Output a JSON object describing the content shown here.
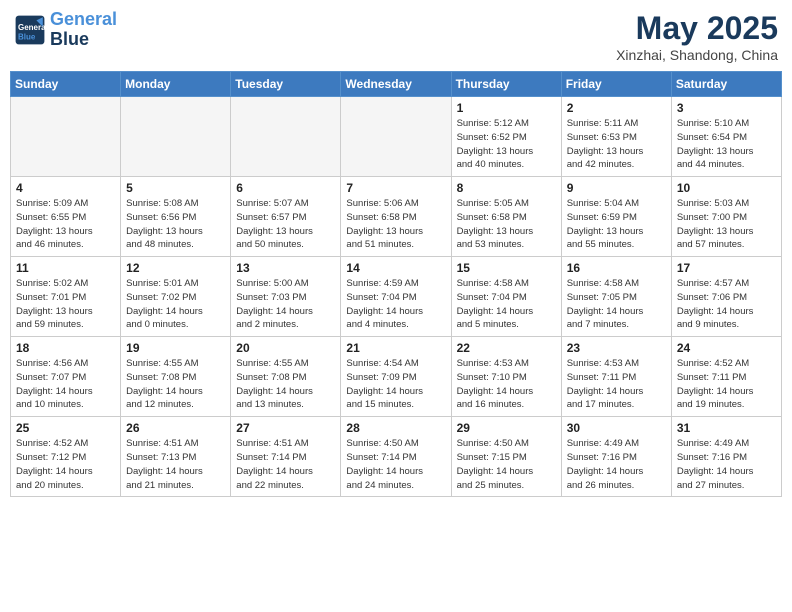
{
  "header": {
    "logo_line1": "General",
    "logo_line2": "Blue",
    "month": "May 2025",
    "location": "Xinzhai, Shandong, China"
  },
  "days_of_week": [
    "Sunday",
    "Monday",
    "Tuesday",
    "Wednesday",
    "Thursday",
    "Friday",
    "Saturday"
  ],
  "weeks": [
    [
      {
        "day": "",
        "info": ""
      },
      {
        "day": "",
        "info": ""
      },
      {
        "day": "",
        "info": ""
      },
      {
        "day": "",
        "info": ""
      },
      {
        "day": "1",
        "info": "Sunrise: 5:12 AM\nSunset: 6:52 PM\nDaylight: 13 hours\nand 40 minutes."
      },
      {
        "day": "2",
        "info": "Sunrise: 5:11 AM\nSunset: 6:53 PM\nDaylight: 13 hours\nand 42 minutes."
      },
      {
        "day": "3",
        "info": "Sunrise: 5:10 AM\nSunset: 6:54 PM\nDaylight: 13 hours\nand 44 minutes."
      }
    ],
    [
      {
        "day": "4",
        "info": "Sunrise: 5:09 AM\nSunset: 6:55 PM\nDaylight: 13 hours\nand 46 minutes."
      },
      {
        "day": "5",
        "info": "Sunrise: 5:08 AM\nSunset: 6:56 PM\nDaylight: 13 hours\nand 48 minutes."
      },
      {
        "day": "6",
        "info": "Sunrise: 5:07 AM\nSunset: 6:57 PM\nDaylight: 13 hours\nand 50 minutes."
      },
      {
        "day": "7",
        "info": "Sunrise: 5:06 AM\nSunset: 6:58 PM\nDaylight: 13 hours\nand 51 minutes."
      },
      {
        "day": "8",
        "info": "Sunrise: 5:05 AM\nSunset: 6:58 PM\nDaylight: 13 hours\nand 53 minutes."
      },
      {
        "day": "9",
        "info": "Sunrise: 5:04 AM\nSunset: 6:59 PM\nDaylight: 13 hours\nand 55 minutes."
      },
      {
        "day": "10",
        "info": "Sunrise: 5:03 AM\nSunset: 7:00 PM\nDaylight: 13 hours\nand 57 minutes."
      }
    ],
    [
      {
        "day": "11",
        "info": "Sunrise: 5:02 AM\nSunset: 7:01 PM\nDaylight: 13 hours\nand 59 minutes."
      },
      {
        "day": "12",
        "info": "Sunrise: 5:01 AM\nSunset: 7:02 PM\nDaylight: 14 hours\nand 0 minutes."
      },
      {
        "day": "13",
        "info": "Sunrise: 5:00 AM\nSunset: 7:03 PM\nDaylight: 14 hours\nand 2 minutes."
      },
      {
        "day": "14",
        "info": "Sunrise: 4:59 AM\nSunset: 7:04 PM\nDaylight: 14 hours\nand 4 minutes."
      },
      {
        "day": "15",
        "info": "Sunrise: 4:58 AM\nSunset: 7:04 PM\nDaylight: 14 hours\nand 5 minutes."
      },
      {
        "day": "16",
        "info": "Sunrise: 4:58 AM\nSunset: 7:05 PM\nDaylight: 14 hours\nand 7 minutes."
      },
      {
        "day": "17",
        "info": "Sunrise: 4:57 AM\nSunset: 7:06 PM\nDaylight: 14 hours\nand 9 minutes."
      }
    ],
    [
      {
        "day": "18",
        "info": "Sunrise: 4:56 AM\nSunset: 7:07 PM\nDaylight: 14 hours\nand 10 minutes."
      },
      {
        "day": "19",
        "info": "Sunrise: 4:55 AM\nSunset: 7:08 PM\nDaylight: 14 hours\nand 12 minutes."
      },
      {
        "day": "20",
        "info": "Sunrise: 4:55 AM\nSunset: 7:08 PM\nDaylight: 14 hours\nand 13 minutes."
      },
      {
        "day": "21",
        "info": "Sunrise: 4:54 AM\nSunset: 7:09 PM\nDaylight: 14 hours\nand 15 minutes."
      },
      {
        "day": "22",
        "info": "Sunrise: 4:53 AM\nSunset: 7:10 PM\nDaylight: 14 hours\nand 16 minutes."
      },
      {
        "day": "23",
        "info": "Sunrise: 4:53 AM\nSunset: 7:11 PM\nDaylight: 14 hours\nand 17 minutes."
      },
      {
        "day": "24",
        "info": "Sunrise: 4:52 AM\nSunset: 7:11 PM\nDaylight: 14 hours\nand 19 minutes."
      }
    ],
    [
      {
        "day": "25",
        "info": "Sunrise: 4:52 AM\nSunset: 7:12 PM\nDaylight: 14 hours\nand 20 minutes."
      },
      {
        "day": "26",
        "info": "Sunrise: 4:51 AM\nSunset: 7:13 PM\nDaylight: 14 hours\nand 21 minutes."
      },
      {
        "day": "27",
        "info": "Sunrise: 4:51 AM\nSunset: 7:14 PM\nDaylight: 14 hours\nand 22 minutes."
      },
      {
        "day": "28",
        "info": "Sunrise: 4:50 AM\nSunset: 7:14 PM\nDaylight: 14 hours\nand 24 minutes."
      },
      {
        "day": "29",
        "info": "Sunrise: 4:50 AM\nSunset: 7:15 PM\nDaylight: 14 hours\nand 25 minutes."
      },
      {
        "day": "30",
        "info": "Sunrise: 4:49 AM\nSunset: 7:16 PM\nDaylight: 14 hours\nand 26 minutes."
      },
      {
        "day": "31",
        "info": "Sunrise: 4:49 AM\nSunset: 7:16 PM\nDaylight: 14 hours\nand 27 minutes."
      }
    ]
  ]
}
